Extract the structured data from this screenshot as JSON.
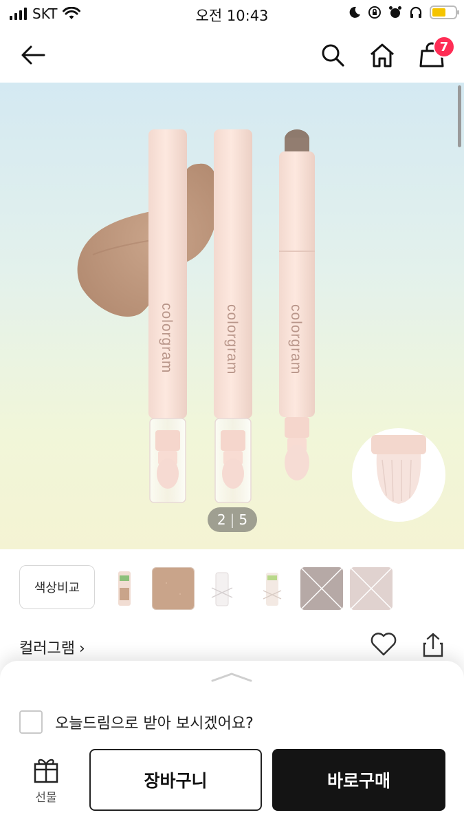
{
  "status_bar": {
    "carrier": "SKT",
    "time": "오전 10:43"
  },
  "nav": {
    "cart_count": "7"
  },
  "product_image": {
    "brand_text_on_product": "colorgram",
    "current_index": "2",
    "separator": "|",
    "total": "5"
  },
  "thumbnails": {
    "compare_label": "색상비교",
    "colors": {
      "swatch": "#c9a48a",
      "grey": "#b6a9a6",
      "pink": "#e0d2cf"
    }
  },
  "brand_row": {
    "brand_name": "컬러그램",
    "chevron": "›"
  },
  "bottom_sheet": {
    "today_dream_label": "오늘드림으로 받아 보시겠어요?",
    "gift_label": "선물",
    "cart_button": "장바구니",
    "buy_button": "바로구매"
  }
}
